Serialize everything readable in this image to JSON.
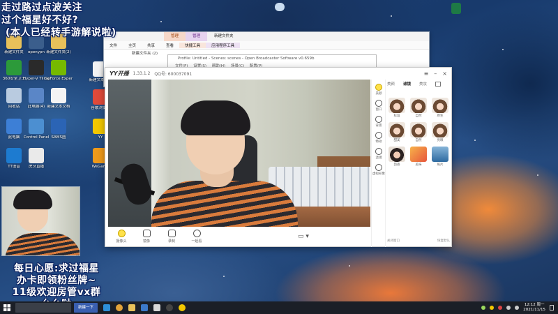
{
  "overlay": {
    "top_lines": [
      "走过路过点波关注",
      "过个福星好不好?",
      "(本人已经转手游解说啦)"
    ],
    "bottom_lines": [
      "每日心愿:求过福星",
      "办卡即领粉丝牌~",
      "11级欢迎房管vx群",
      "么么哒"
    ]
  },
  "desktop_icons": [
    {
      "label": "新建文件夹",
      "icon": "folder-icon",
      "color": "#e8c15a"
    },
    {
      "label": "openypn",
      "icon": "vpn-icon",
      "color": "#3b5e8c"
    },
    {
      "label": "新建文件夹(2)",
      "icon": "folder-icon",
      "color": "#e8c15a"
    },
    {
      "label": "360安全卫士",
      "icon": "shield-icon",
      "color": "#2c9a3a"
    },
    {
      "label": "Hyper-V Tiling",
      "icon": "app-icon",
      "color": "#2a2a2a"
    },
    {
      "label": "GeForce Experience",
      "icon": "nvidia-icon",
      "color": "#76b900"
    },
    {
      "label": "回收站",
      "icon": "recycle-icon",
      "color": "#b9cbe0"
    },
    {
      "label": "此电脑(4)",
      "icon": "pc-icon",
      "color": "#5a86c7"
    },
    {
      "label": "新建文本文档",
      "icon": "doc-icon",
      "color": "#f4f4f4"
    },
    {
      "label": "此电脑",
      "icon": "pc-icon",
      "color": "#3d7fd6"
    },
    {
      "label": "Control Panel",
      "icon": "panel-icon",
      "color": "#4c8fd1"
    },
    {
      "label": "SAMS图",
      "icon": "app-icon",
      "color": "#2b64b5"
    },
    {
      "label": "TT语音",
      "icon": "voice-icon",
      "color": "#1d7bd0"
    },
    {
      "label": "虎牙直播",
      "icon": "doc-icon",
      "color": "#eaeaea"
    },
    {
      "label": "谷歌浏览器",
      "icon": "chrome-icon",
      "color": "#e04a3a"
    },
    {
      "label": "YY",
      "icon": "yy-icon",
      "color": "#f2c700"
    },
    {
      "label": "WeGame",
      "icon": "game-icon",
      "color": "#ef9a1a"
    },
    {
      "label": "新建文本文档",
      "icon": "doc-icon",
      "color": "#f3f3f3"
    }
  ],
  "explorer": {
    "tab_manage_1": "管理",
    "tab_manage_2": "管理",
    "tab_title": "新建文件夹",
    "ribbon": [
      "文件",
      "主页",
      "共享",
      "查看",
      "快捷工具",
      "应用程序工具"
    ],
    "address": "新建文件夹 (2)"
  },
  "obs": {
    "title": "Profile: Untitled - Scenes: scenes - Open Broadcaster Software v0.659b",
    "menu": [
      "文件(F)",
      "设置(S)",
      "帮助(H)",
      "场景(C)",
      "配置(P)"
    ]
  },
  "yy": {
    "logo": "YY开播",
    "version": "1.33.1.2",
    "qq": "QQ号: 600037091",
    "toolbar": [
      "摄像头",
      "镜像",
      "录制",
      "一起看"
    ],
    "panel_tabs": [
      "美颜",
      "滤镜",
      "美妆"
    ],
    "side_items": [
      "美颜",
      "窗口",
      "背景",
      "特效",
      "滤镜",
      "虚拟形象"
    ],
    "faces": [
      "标准",
      "自然",
      "原生",
      "甜美",
      "自然",
      "亮眼",
      "韵姿",
      "美味",
      "照片"
    ],
    "panel_footer": [
      "关闭窗口",
      "恢复默认"
    ]
  },
  "taskbar": {
    "task_label": "新建一下",
    "time": "12:12 周一",
    "date": "2021/11/15"
  }
}
